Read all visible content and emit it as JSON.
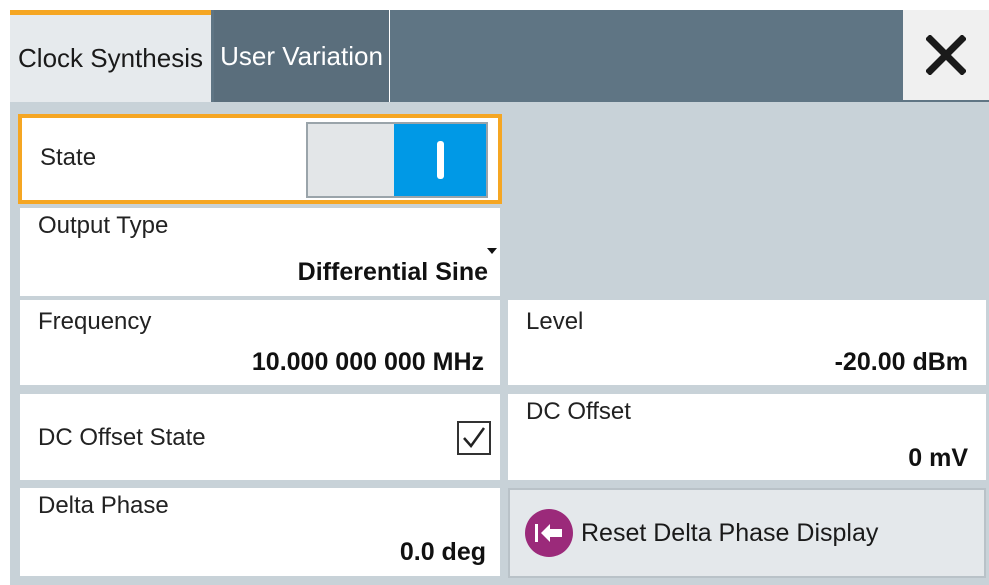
{
  "tabs": [
    {
      "label": "Clock Synthesis",
      "active": true
    },
    {
      "label": "User Variation",
      "active": false
    }
  ],
  "close_icon": "close-icon",
  "state": {
    "label": "State",
    "value": "on"
  },
  "output_type": {
    "label": "Output Type",
    "value": "Differential Sine"
  },
  "frequency": {
    "label": "Frequency",
    "value": "10.000 000 000 MHz"
  },
  "level": {
    "label": "Level",
    "value": "-20.00 dBm"
  },
  "dc_offset_state": {
    "label": "DC Offset State",
    "checked": true
  },
  "dc_offset": {
    "label": "DC Offset",
    "value": "0 mV"
  },
  "delta_phase": {
    "label": "Delta Phase",
    "value": "0.0 deg"
  },
  "reset_button": {
    "label": "Reset Delta Phase Display",
    "icon": "reset-arrow-icon"
  },
  "colors": {
    "accent": "#f5a623",
    "toggle_on": "#0099e6",
    "tabbar": "#5f7584",
    "reset_icon": "#9b2a7a"
  }
}
